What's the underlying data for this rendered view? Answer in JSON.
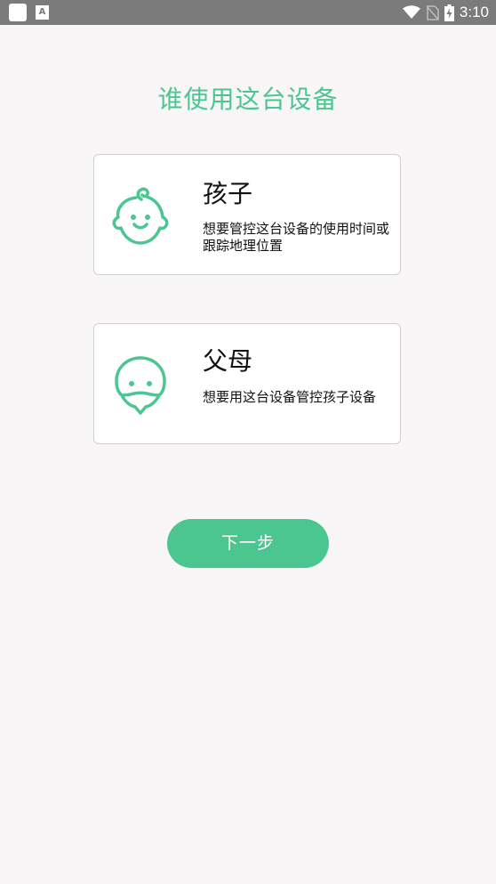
{
  "status_bar": {
    "time": "3:10",
    "icons": [
      "app-square-icon",
      "a-letter-icon",
      "wifi-icon",
      "no-sim-icon",
      "battery-charging-icon"
    ]
  },
  "page": {
    "title": "谁使用这台设备"
  },
  "options": [
    {
      "title": "孩子",
      "description": "想要管控这台设备的使用时间或跟踪地理位置",
      "icon": "baby-face-icon"
    },
    {
      "title": "父母",
      "description": "想要用这台设备管控孩子设备",
      "icon": "adult-face-icon"
    }
  ],
  "next_button": {
    "label": "下一步"
  },
  "colors": {
    "accent": "#4cc690",
    "background": "#f8f6f7",
    "status_bar": "#7b7b7b"
  }
}
